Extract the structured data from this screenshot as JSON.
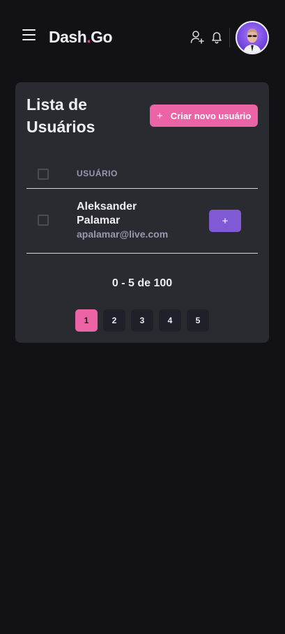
{
  "header": {
    "logo_main": "Dash",
    "logo_dot": ".",
    "logo_suffix": "Go"
  },
  "card": {
    "title": "Lista de Usuários",
    "create_button_icon": "+",
    "create_button_label": "Criar novo usuário"
  },
  "table": {
    "column_user": "USUÁRIO",
    "rows": [
      {
        "name": "Aleksander Palamar",
        "email": "apalamar@live.com",
        "action_label": "+"
      }
    ]
  },
  "pagination": {
    "info": "0 - 5 de 100",
    "pages": [
      "1",
      "2",
      "3",
      "4",
      "5"
    ],
    "current": "1"
  },
  "colors": {
    "background": "#121214",
    "card": "#2a2a31",
    "accent_pink": "#ed64a6",
    "accent_purple": "#805ad5",
    "muted_text": "#9699b0"
  }
}
